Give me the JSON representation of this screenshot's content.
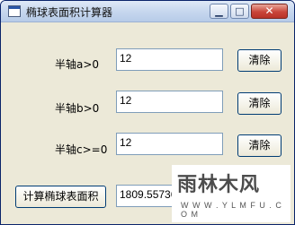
{
  "window": {
    "title": "椭球表面积计算器",
    "min_icon": "minimize-icon",
    "max_icon": "maximize-icon",
    "close_icon": "close-icon"
  },
  "rows": [
    {
      "label": "半轴a>0",
      "value": "12",
      "clear_label": "清除"
    },
    {
      "label": "半轴b>0",
      "value": "12",
      "clear_label": "清除"
    },
    {
      "label": "半轴c>=0",
      "value": "12",
      "clear_label": "清除"
    }
  ],
  "result": {
    "button_label": "计算椭球表面积",
    "value": "1809.55736"
  },
  "watermark": {
    "main": "雨林木风",
    "sub": "W W W . Y L M F U . C O M"
  }
}
